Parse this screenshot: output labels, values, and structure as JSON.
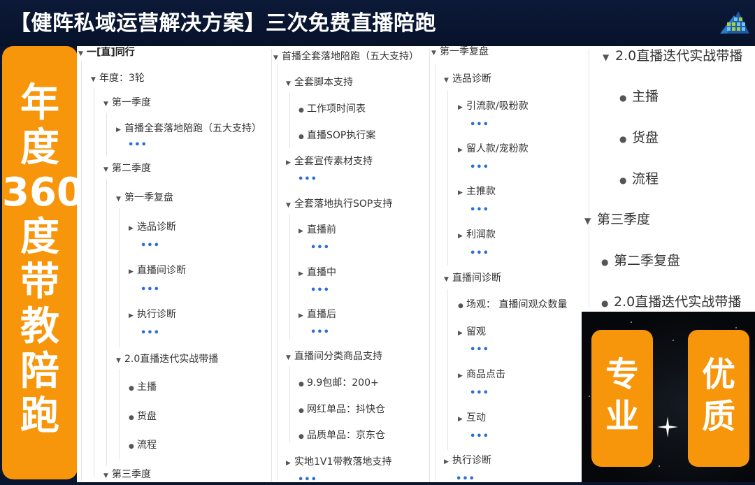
{
  "header": {
    "title": "【健阵私域运营解决方案】三次免费直播陪跑"
  },
  "sidebar": {
    "text": "年\n度\n360\n度\n带\n教\n陪\n跑"
  },
  "badges": {
    "left": "专\n业",
    "right": "优\n质"
  },
  "more_glyph": "•••",
  "mindmap": {
    "col1": {
      "root": "一[直]同行",
      "year": "年度：3轮",
      "q1": "第一季度",
      "q1_child": "首播全套落地陪跑（五大支持）",
      "q2": "第二季度",
      "q2_review": "第一季复盘",
      "diag_product": "选品诊断",
      "diag_room": "直播间诊断",
      "diag_exec": "执行诊断",
      "iter": "2.0直播迭代实战带播",
      "host": "主播",
      "goods": "货盘",
      "flow": "流程",
      "q3": "第三季度"
    },
    "col2": {
      "root": "首播全套落地陪跑（五大支持）",
      "script": "全套脚本支持",
      "schedule": "工作项时间表",
      "sop_plan": "直播SOP执行案",
      "promo": "全套宣传素材支持",
      "exec_sop": "全套落地执行SOP支持",
      "before": "直播前",
      "during": "直播中",
      "after": "直播后",
      "category": "直播间分类商品支持",
      "free_ship": "9.9包邮：200+",
      "influencer": "网红单品：抖快仓",
      "quality": "品质单品：京东仓",
      "onsite": "实地1V1带教落地支持"
    },
    "col3": {
      "root": "第一季复盘",
      "product_diag": "选品诊断",
      "traffic": "引流款/吸粉款",
      "retain": "留人款/宠粉款",
      "main_push": "主推款",
      "profit": "利润款",
      "room_diag": "直播间诊断",
      "viewers": "场观：  直播间观众数量",
      "stay": "留观",
      "click": "商品点击",
      "interact": "互动",
      "exec_diag": "执行诊断"
    },
    "col4": {
      "iter": "2.0直播迭代实战带播",
      "host": "主播",
      "goods": "货盘",
      "flow": "流程",
      "q3": "第三季度",
      "q2_review": "第二季复盘",
      "iter2": "2.0直播迭代实战带播"
    }
  }
}
